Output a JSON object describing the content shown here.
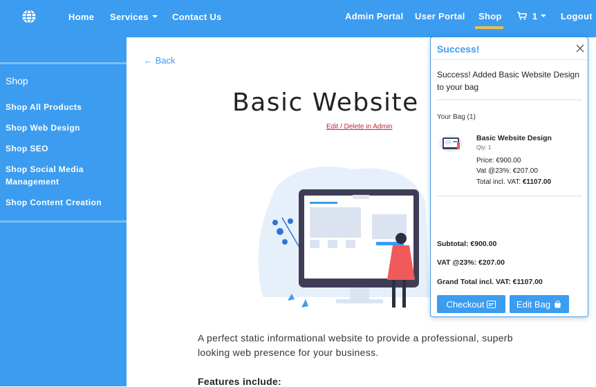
{
  "navbar": {
    "brand_icon": "globe-icon",
    "home": "Home",
    "services": "Services",
    "contact": "Contact Us",
    "admin_portal": "Admin Portal",
    "user_portal": "User Portal",
    "shop": "Shop",
    "cart_count": "1",
    "cart_icon": "cart-icon",
    "logout": "Logout",
    "accent_underline": "#e8c14a"
  },
  "sidebar": {
    "heading": "Shop",
    "items": [
      {
        "label": "Shop All Products"
      },
      {
        "label": "Shop Web Design"
      },
      {
        "label": "Shop SEO"
      },
      {
        "label": "Shop Social Media Management"
      },
      {
        "label": "Shop Content Creation"
      }
    ]
  },
  "main": {
    "back": "← Back",
    "title": "Basic Website Design",
    "admin_link": "Edit / Delete in Admin",
    "description": "A perfect static informational website to provide a professional, superb looking web presence for your business.",
    "features_heading": "Features include:"
  },
  "popup": {
    "title": "Success!",
    "message": "Success! Added Basic Website Design to your bag",
    "bag_label": "Your Bag (1)",
    "item": {
      "name": "Basic Website Design",
      "qty": "Qty: 1",
      "price": "Price: €900.00",
      "vat": "Vat @23%: €207.00",
      "total_label": "Total incl. VAT: ",
      "total_value": "€1107.00"
    },
    "subtotal": "Subtotal: €900.00",
    "vat": "VAT @23%: €207.00",
    "grand_total": "Grand Total incl. VAT: €1107.00",
    "checkout": "Checkout",
    "edit_bag": "Edit Bag"
  },
  "colors": {
    "brand_blue": "#3b9cf0",
    "admin_link": "#c0253a"
  }
}
